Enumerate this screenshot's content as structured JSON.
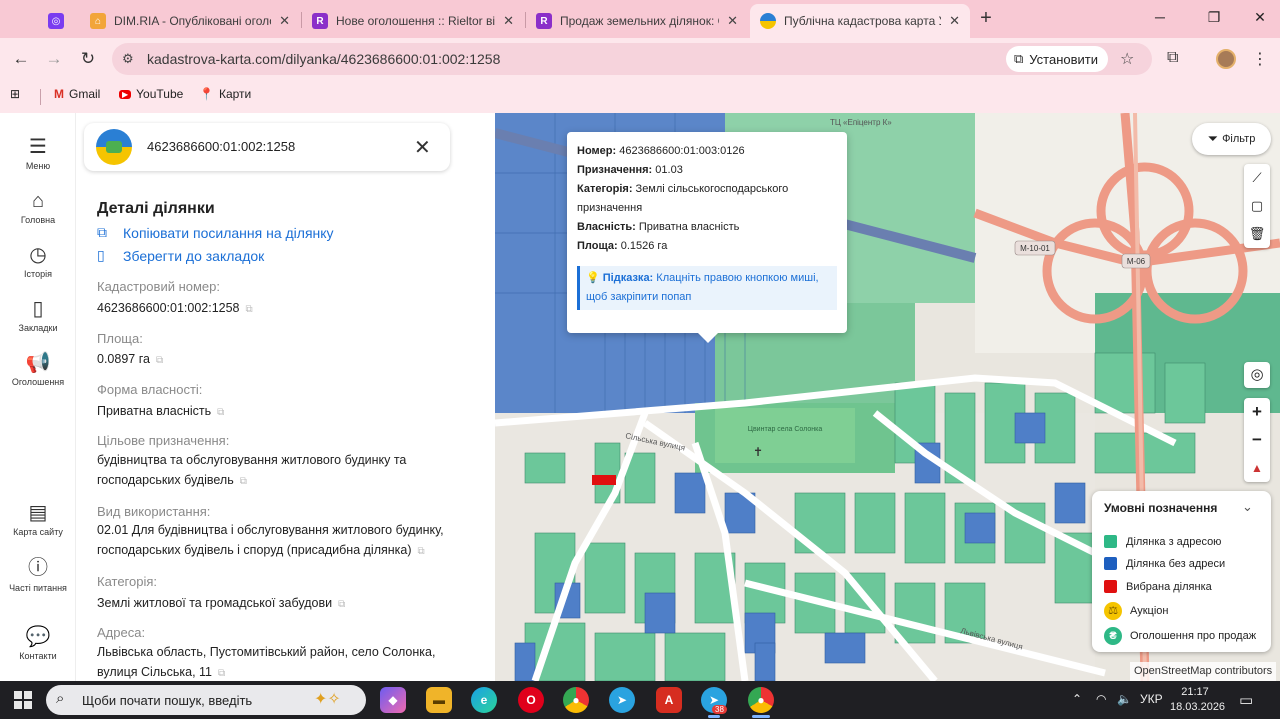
{
  "browser": {
    "tabs": [
      {
        "title": "",
        "icon": "app-icon",
        "color": "#7a3cf0"
      },
      {
        "title": "DIM.RIA - Опубліковані оголош",
        "icon": "dimria-icon",
        "color": "#f2a53a"
      },
      {
        "title": "Нове оголошення :: Rieltor від",
        "icon": "rieltor-icon",
        "color": "#8b2fc9"
      },
      {
        "title": "Продаж земельних ділянок: Сі",
        "icon": "rieltor-icon",
        "color": "#8b2fc9"
      },
      {
        "title": "Публічна кадастрова карта Ук",
        "icon": "kadastr-icon",
        "color": "#2a7fd4"
      }
    ],
    "url": "kadastrova-karta.com/dilyanka/4623686600:01:002:1258",
    "install_label": "Установити",
    "bookmarks": [
      {
        "label": "Gmail",
        "icon": "gmail-icon"
      },
      {
        "label": "YouTube",
        "icon": "youtube-icon"
      },
      {
        "label": "Карти",
        "icon": "maps-icon"
      }
    ]
  },
  "left_nav": [
    {
      "label": "Меню",
      "icon": "menu-icon"
    },
    {
      "label": "Головна",
      "icon": "home-icon"
    },
    {
      "label": "Історія",
      "icon": "history-icon"
    },
    {
      "label": "Закладки",
      "icon": "bookmark-icon"
    },
    {
      "label": "Оголошення",
      "icon": "megaphone-icon"
    },
    {
      "label": "Карта сайту",
      "icon": "sitemap-icon"
    },
    {
      "label": "Часті питання",
      "icon": "faq-icon"
    },
    {
      "label": "Контакти",
      "icon": "contacts-icon"
    }
  ],
  "search": {
    "value": "4623686600:01:002:1258"
  },
  "details": {
    "title": "Деталі ділянки",
    "copy_link": "Копіювати посилання на ділянку",
    "save_bookmark": "Зберегти до закладок",
    "fields": [
      {
        "label": "Кадастровий номер:",
        "value": "4623686600:01:002:1258"
      },
      {
        "label": "Площа:",
        "value": "0.0897 га"
      },
      {
        "label": "Форма власності:",
        "value": "Приватна власність"
      },
      {
        "label": "Цільове призначення:",
        "value": "будівництва та обслуговування житлового будинку та господарських будівель"
      },
      {
        "label": "Вид використання:",
        "value": "02.01 Для будівництва і обслуговування житлового будинку, господарських будівель і споруд (присадибна ділянка)"
      },
      {
        "label": "Категорія:",
        "value": "Землі житлової та громадської забудови"
      },
      {
        "label": "Адреса:",
        "value": "Львівська область, Пустомитівський район, село Солонка, вулиця Сільська, 11"
      }
    ]
  },
  "popup": {
    "number_label": "Номер:",
    "number": "4623686600:01:003:0126",
    "purpose_label": "Призначення:",
    "purpose": "01.03",
    "category_label": "Категорія:",
    "category": "Землі сільськогосподарського призначення",
    "ownership_label": "Власність:",
    "ownership": "Приватна власність",
    "area_label": "Площа:",
    "area": "0.1526 га",
    "hint_label": "Підказка:",
    "hint": "Клацніть правою кнопкою миші, щоб закріпити попап"
  },
  "map": {
    "filter_label": "Фільтр",
    "road_labels": [
      "М-10-01",
      "М-06"
    ],
    "street_labels": [
      "Сільська вулиця",
      "Цвинтар села Солонка",
      "Львівська вулиця",
      "ТЦ «Епіцентр К»"
    ],
    "legend": {
      "title": "Умовні позначення",
      "items": [
        {
          "label": "Ділянка з адресою",
          "color": "#2eb886"
        },
        {
          "label": "Ділянка без адреси",
          "color": "#1e5fbf"
        },
        {
          "label": "Вибрана ділянка",
          "color": "#e01010"
        },
        {
          "label": "Аукціон",
          "color": "#f5c400"
        },
        {
          "label": "Оголошення про продаж",
          "color": "#2eb886"
        }
      ]
    },
    "attribution": "OpenStreetMap contributors"
  },
  "taskbar": {
    "search_placeholder": "Щоби почати пошук, введіть",
    "telegram_badge": "38",
    "language": "УКР",
    "time": "21:17",
    "date": "18.03.2026"
  }
}
